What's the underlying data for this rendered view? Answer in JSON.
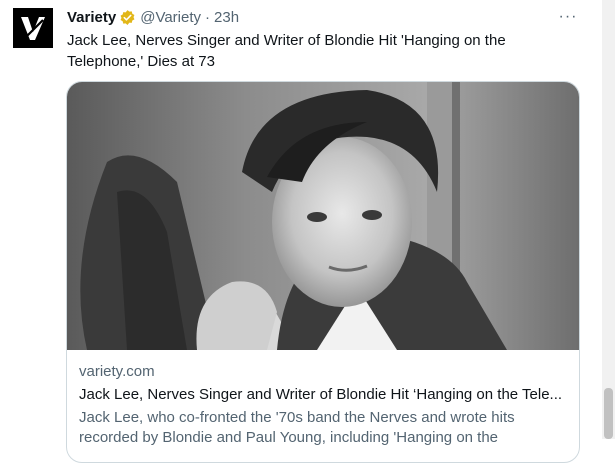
{
  "tweet": {
    "author_name": "Variety",
    "author_handle": "@Variety",
    "separator": "·",
    "time": "23h",
    "more": "···",
    "text": "Jack Lee, Nerves Singer and Writer of Blondie Hit 'Hanging on the Telephone,' Dies at 73",
    "verified_color": "#e2b719",
    "avatar_icon": "variety-v-logo-icon"
  },
  "card": {
    "domain": "variety.com",
    "title": "Jack Lee, Nerves Singer and Writer of Blondie Hit ‘Hanging on the Tele...",
    "description": "Jack Lee, who co-fronted the '70s band the Nerves and wrote hits recorded by Blondie and Paul Young, including 'Hanging on the"
  }
}
